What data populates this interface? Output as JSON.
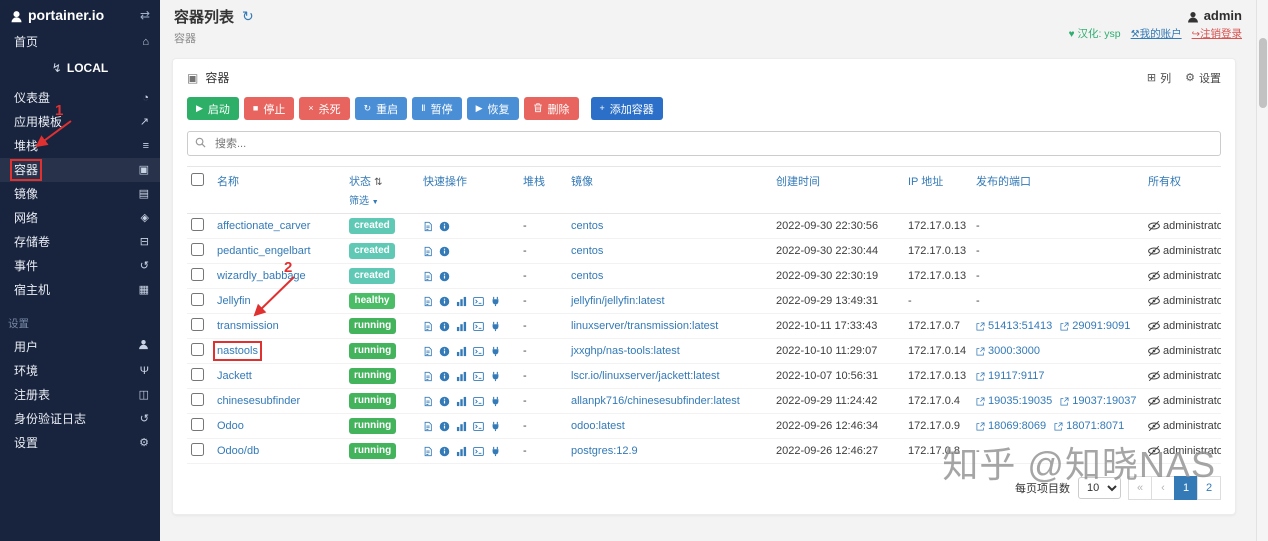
{
  "colors": {
    "sidebar_bg": "#18233d",
    "link": "#337ab7",
    "success": "#2daf67",
    "danger": "#e8655f",
    "info": "#4a8fd6",
    "primary": "#2b6fc8",
    "annotation": "#e03131",
    "badge": {
      "created": "#5fc9b6",
      "healthy": "#4abd66",
      "running": "#43b35c"
    }
  },
  "sidebar": {
    "logo_text": "portainer.io",
    "home_label": "首页",
    "endpoint_label": "LOCAL",
    "section_label": "设置",
    "menu": [
      {
        "id": "dashboard",
        "label": "仪表盘",
        "icon": "dashboard-icon"
      },
      {
        "id": "app-templates",
        "label": "应用模板",
        "icon": "rocket-icon"
      },
      {
        "id": "stacks",
        "label": "堆栈",
        "icon": "stacks-icon"
      },
      {
        "id": "containers",
        "label": "容器",
        "icon": "containers-icon",
        "active": true
      },
      {
        "id": "images",
        "label": "镜像",
        "icon": "images-icon"
      },
      {
        "id": "networks",
        "label": "网络",
        "icon": "network-icon"
      },
      {
        "id": "volumes",
        "label": "存储卷",
        "icon": "volumes-icon"
      },
      {
        "id": "events",
        "label": "事件",
        "icon": "events-icon"
      },
      {
        "id": "host",
        "label": "宿主机",
        "icon": "host-icon"
      }
    ],
    "settings_menu": [
      {
        "id": "users",
        "label": "用户",
        "icon": "users-icon"
      },
      {
        "id": "environments",
        "label": "环境",
        "icon": "environments-icon"
      },
      {
        "id": "registries",
        "label": "注册表",
        "icon": "registries-icon"
      },
      {
        "id": "auth-logs",
        "label": "身份验证日志",
        "icon": "auth-logs-icon"
      },
      {
        "id": "settings",
        "label": "设置",
        "icon": "settings-icon"
      }
    ]
  },
  "header": {
    "title": "容器列表",
    "subtitle": "容器",
    "username": "admin",
    "hanhua": "汉化: ysp",
    "account": "我的账户",
    "logout": "注销登录"
  },
  "panel": {
    "title": "容器",
    "columns_label": "列",
    "settings_label": "设置"
  },
  "toolbar": {
    "buttons": [
      {
        "id": "start",
        "label": "启动",
        "icon": "play-icon",
        "color": "#2daf67"
      },
      {
        "id": "stop",
        "label": "停止",
        "icon": "stop-icon",
        "color": "#e8655f"
      },
      {
        "id": "kill",
        "label": "杀死",
        "icon": "kill-icon",
        "color": "#e8655f"
      },
      {
        "id": "restart",
        "label": "重启",
        "icon": "restart-icon",
        "color": "#4a8fd6"
      },
      {
        "id": "pause",
        "label": "暂停",
        "icon": "pause-icon",
        "color": "#4a8fd6"
      },
      {
        "id": "resume",
        "label": "恢复",
        "icon": "resume-icon",
        "color": "#4a8fd6"
      },
      {
        "id": "remove",
        "label": "删除",
        "icon": "trash-icon",
        "color": "#e8655f"
      }
    ],
    "add_button": {
      "id": "add-container",
      "label": "添加容器",
      "icon": "plus-icon",
      "color": "#2b6fc8"
    }
  },
  "search": {
    "placeholder": "搜索..."
  },
  "table": {
    "headers": {
      "name": "名称",
      "state": "状态",
      "state_filter": "筛选",
      "quick_actions": "快速操作",
      "stack": "堆栈",
      "image": "镜像",
      "created": "创建时间",
      "ip": "IP 地址",
      "ports": "发布的端口",
      "ownership": "所有权"
    },
    "rows": [
      {
        "name": "affectionate_carver",
        "state": "created",
        "actions": [
          "logs",
          "inspect"
        ],
        "stack": "-",
        "image": "centos",
        "created": "2022-09-30 22:30:56",
        "ip": "172.17.0.13",
        "ports": [],
        "ownership": "administrators"
      },
      {
        "name": "pedantic_engelbart",
        "state": "created",
        "actions": [
          "logs",
          "inspect"
        ],
        "stack": "-",
        "image": "centos",
        "created": "2022-09-30 22:30:44",
        "ip": "172.17.0.13",
        "ports": [],
        "ownership": "administrators"
      },
      {
        "name": "wizardly_babbage",
        "state": "created",
        "actions": [
          "logs",
          "inspect"
        ],
        "stack": "-",
        "image": "centos",
        "created": "2022-09-30 22:30:19",
        "ip": "172.17.0.13",
        "ports": [],
        "ownership": "administrators"
      },
      {
        "name": "Jellyfin",
        "state": "healthy",
        "actions": [
          "logs",
          "inspect",
          "stats",
          "console",
          "attach"
        ],
        "stack": "-",
        "image": "jellyfin/jellyfin:latest",
        "created": "2022-09-29 13:49:31",
        "ip": "-",
        "ports": [],
        "ownership": "administrators"
      },
      {
        "name": "transmission",
        "state": "running",
        "actions": [
          "logs",
          "inspect",
          "stats",
          "console",
          "attach"
        ],
        "stack": "-",
        "image": "linuxserver/transmission:latest",
        "created": "2022-10-11 17:33:43",
        "ip": "172.17.0.7",
        "ports": [
          "51413:51413",
          "29091:9091"
        ],
        "ownership": "administrators"
      },
      {
        "name": "nastools",
        "state": "running",
        "actions": [
          "logs",
          "inspect",
          "stats",
          "console",
          "attach"
        ],
        "stack": "-",
        "image": "jxxghp/nas-tools:latest",
        "created": "2022-10-10 11:29:07",
        "ip": "172.17.0.14",
        "ports": [
          "3000:3000"
        ],
        "ownership": "administrators"
      },
      {
        "name": "Jackett",
        "state": "running",
        "actions": [
          "logs",
          "inspect",
          "stats",
          "console",
          "attach"
        ],
        "stack": "-",
        "image": "lscr.io/linuxserver/jackett:latest",
        "created": "2022-10-07 10:56:31",
        "ip": "172.17.0.13",
        "ports": [
          "19117:9117"
        ],
        "ownership": "administrators"
      },
      {
        "name": "chinesesubfinder",
        "state": "running",
        "actions": [
          "logs",
          "inspect",
          "stats",
          "console",
          "attach"
        ],
        "stack": "-",
        "image": "allanpk716/chinesesubfinder:latest",
        "created": "2022-09-29 11:24:42",
        "ip": "172.17.0.4",
        "ports": [
          "19035:19035",
          "19037:19037"
        ],
        "ownership": "administrators"
      },
      {
        "name": "Odoo",
        "state": "running",
        "actions": [
          "logs",
          "inspect",
          "stats",
          "console",
          "attach"
        ],
        "stack": "-",
        "image": "odoo:latest",
        "created": "2022-09-26 12:46:34",
        "ip": "172.17.0.9",
        "ports": [
          "18069:8069",
          "18071:8071"
        ],
        "ownership": "administrators"
      },
      {
        "name": "Odoo/db",
        "state": "running",
        "actions": [
          "logs",
          "inspect",
          "stats",
          "console",
          "attach"
        ],
        "stack": "-",
        "image": "postgres:12.9",
        "created": "2022-09-26 12:46:27",
        "ip": "172.17.0.8",
        "ports": [],
        "ownership": "administrators"
      }
    ]
  },
  "pagination": {
    "items_per_page_label": "每页项目数",
    "page_size": "10",
    "pages": [
      {
        "label": "«",
        "state": "muted"
      },
      {
        "label": "‹",
        "state": "muted"
      },
      {
        "label": "1",
        "state": "active"
      },
      {
        "label": "2",
        "state": "normal"
      }
    ]
  },
  "watermark": "知乎 @知晓NAS",
  "annotations": {
    "step1_label": "1",
    "step2_label": "2",
    "boxed_sidebar_item": "containers",
    "boxed_container_name": "nastools"
  }
}
